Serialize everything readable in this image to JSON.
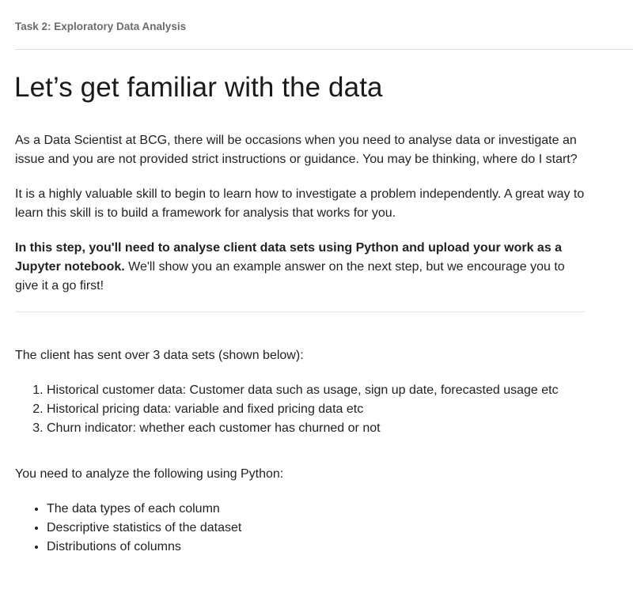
{
  "header": {
    "task_label": "Task 2: Exploratory Data Analysis"
  },
  "title": "Let’s get familiar with the data",
  "paragraphs": {
    "intro": "As a Data Scientist at BCG, there will be occasions when you need to analyse data or investigate an issue and you are not provided strict instructions or guidance. You may be thinking, where do I start?",
    "skill": "It is a highly valuable skill to begin to learn how to investigate a problem independently. A great way to learn this skill is to build a framework for analysis that works for you.",
    "step_bold": "In this step, you'll need to analyse client data sets using Python and upload your work as a Jupyter notebook.",
    "step_rest": " We'll show you an example answer on the next step, but we encourage you to give it a go first!",
    "datasets_intro": "The client has sent over 3 data sets (shown below):",
    "analyze_intro": "You need to analyze the following using Python:"
  },
  "datasets": [
    "Historical customer data: Customer data such as usage, sign up date, forecasted usage etc",
    "Historical pricing data: variable and fixed pricing data etc",
    "Churn indicator: whether each customer has churned or not"
  ],
  "analysis_items": [
    "The data types of each column",
    "Descriptive statistics of the dataset",
    "Distributions of columns"
  ]
}
